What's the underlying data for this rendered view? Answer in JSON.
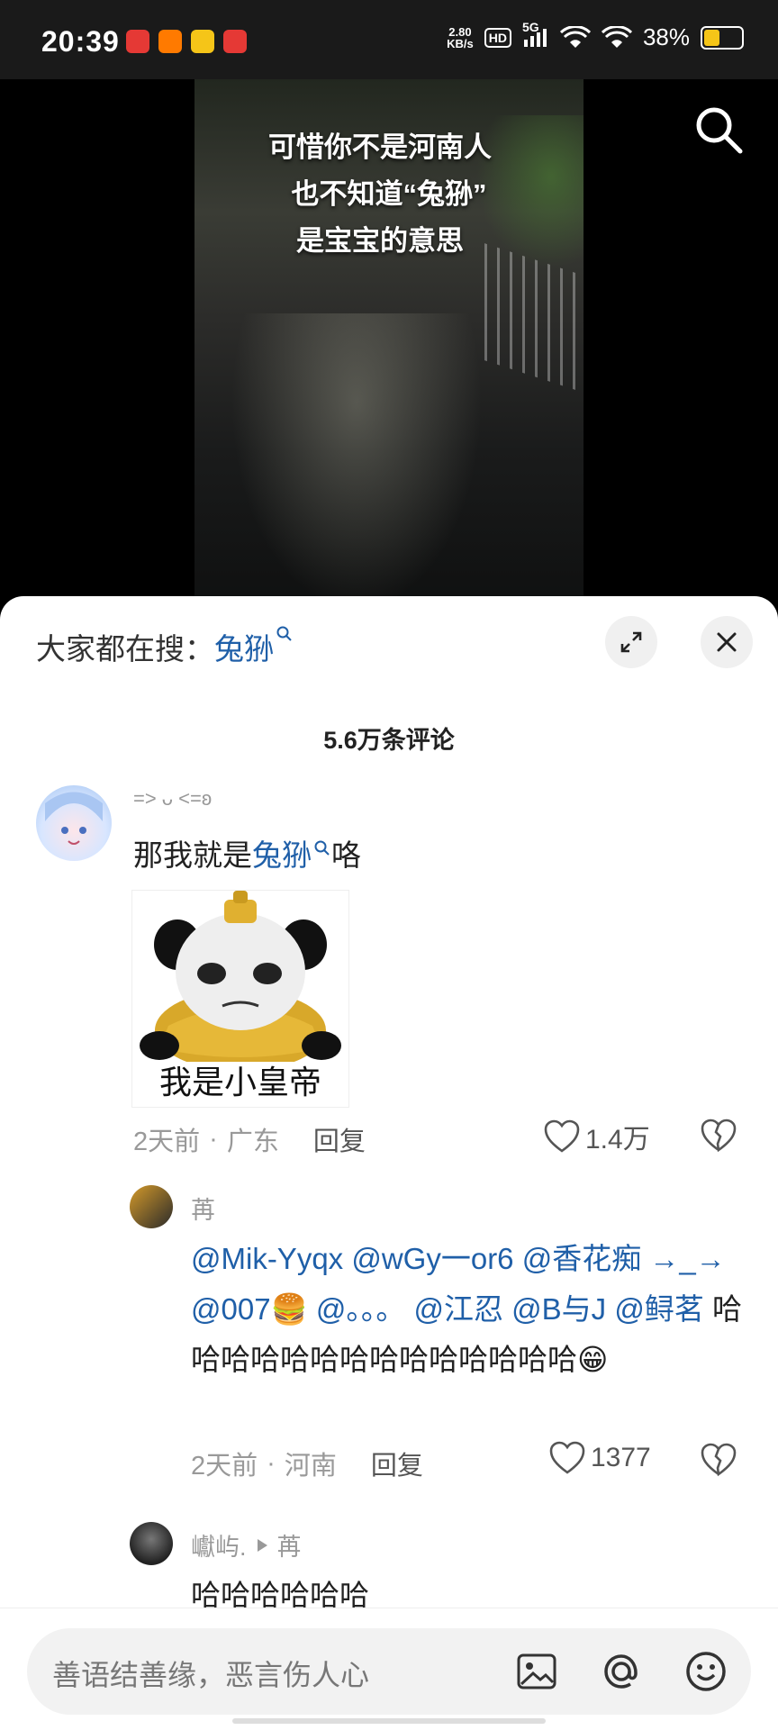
{
  "status_bar": {
    "time": "20:39",
    "net_speed_value": "2.80",
    "net_speed_unit": "KB/s",
    "hd": "HD",
    "network": "5G",
    "battery": "38%",
    "battery_level": 0.38,
    "app_icon_colors": [
      "#e53935",
      "#ff7a00",
      "#f5c518",
      "#e53935"
    ]
  },
  "video": {
    "overlay_lines": [
      "可惜你不是河南人",
      "也不知道“兔狲”",
      "是宝宝的意思"
    ]
  },
  "comments_panel": {
    "hot_search_label": "大家都在搜：",
    "hot_search_term": "兔狲",
    "comment_count": "5.6万条评论",
    "comments": [
      {
        "username": "=> ᴗ <=ʚ",
        "text_prefix": "那我就是",
        "text_link": "兔狲",
        "text_suffix": "咯",
        "sticker_caption": "我是小皇帝",
        "time": "2天前",
        "location": "广东",
        "reply_label": "回复",
        "likes": "1.4万",
        "replies": [
          {
            "username": "苒",
            "mentions": "@Mik-Yyqx @wGy一or6 @香花痴 →_→ @007🍔 @。。。 @江忍 @B与J @鲟茗",
            "text": " 哈哈哈哈哈哈哈哈哈哈哈哈哈哈😁",
            "time": "2天前",
            "location": "河南",
            "reply_label": "回复",
            "likes": "1377"
          },
          {
            "username": "巘屿.",
            "reply_to": "苒",
            "text": "哈哈哈哈哈哈"
          }
        ]
      }
    ]
  },
  "input": {
    "placeholder": "善语结善缘，恶言伤人心"
  },
  "icons": [
    "search-icon",
    "expand-icon",
    "close-icon",
    "heart-icon",
    "broken-heart-icon",
    "image-icon",
    "at-icon",
    "emoji-icon"
  ]
}
